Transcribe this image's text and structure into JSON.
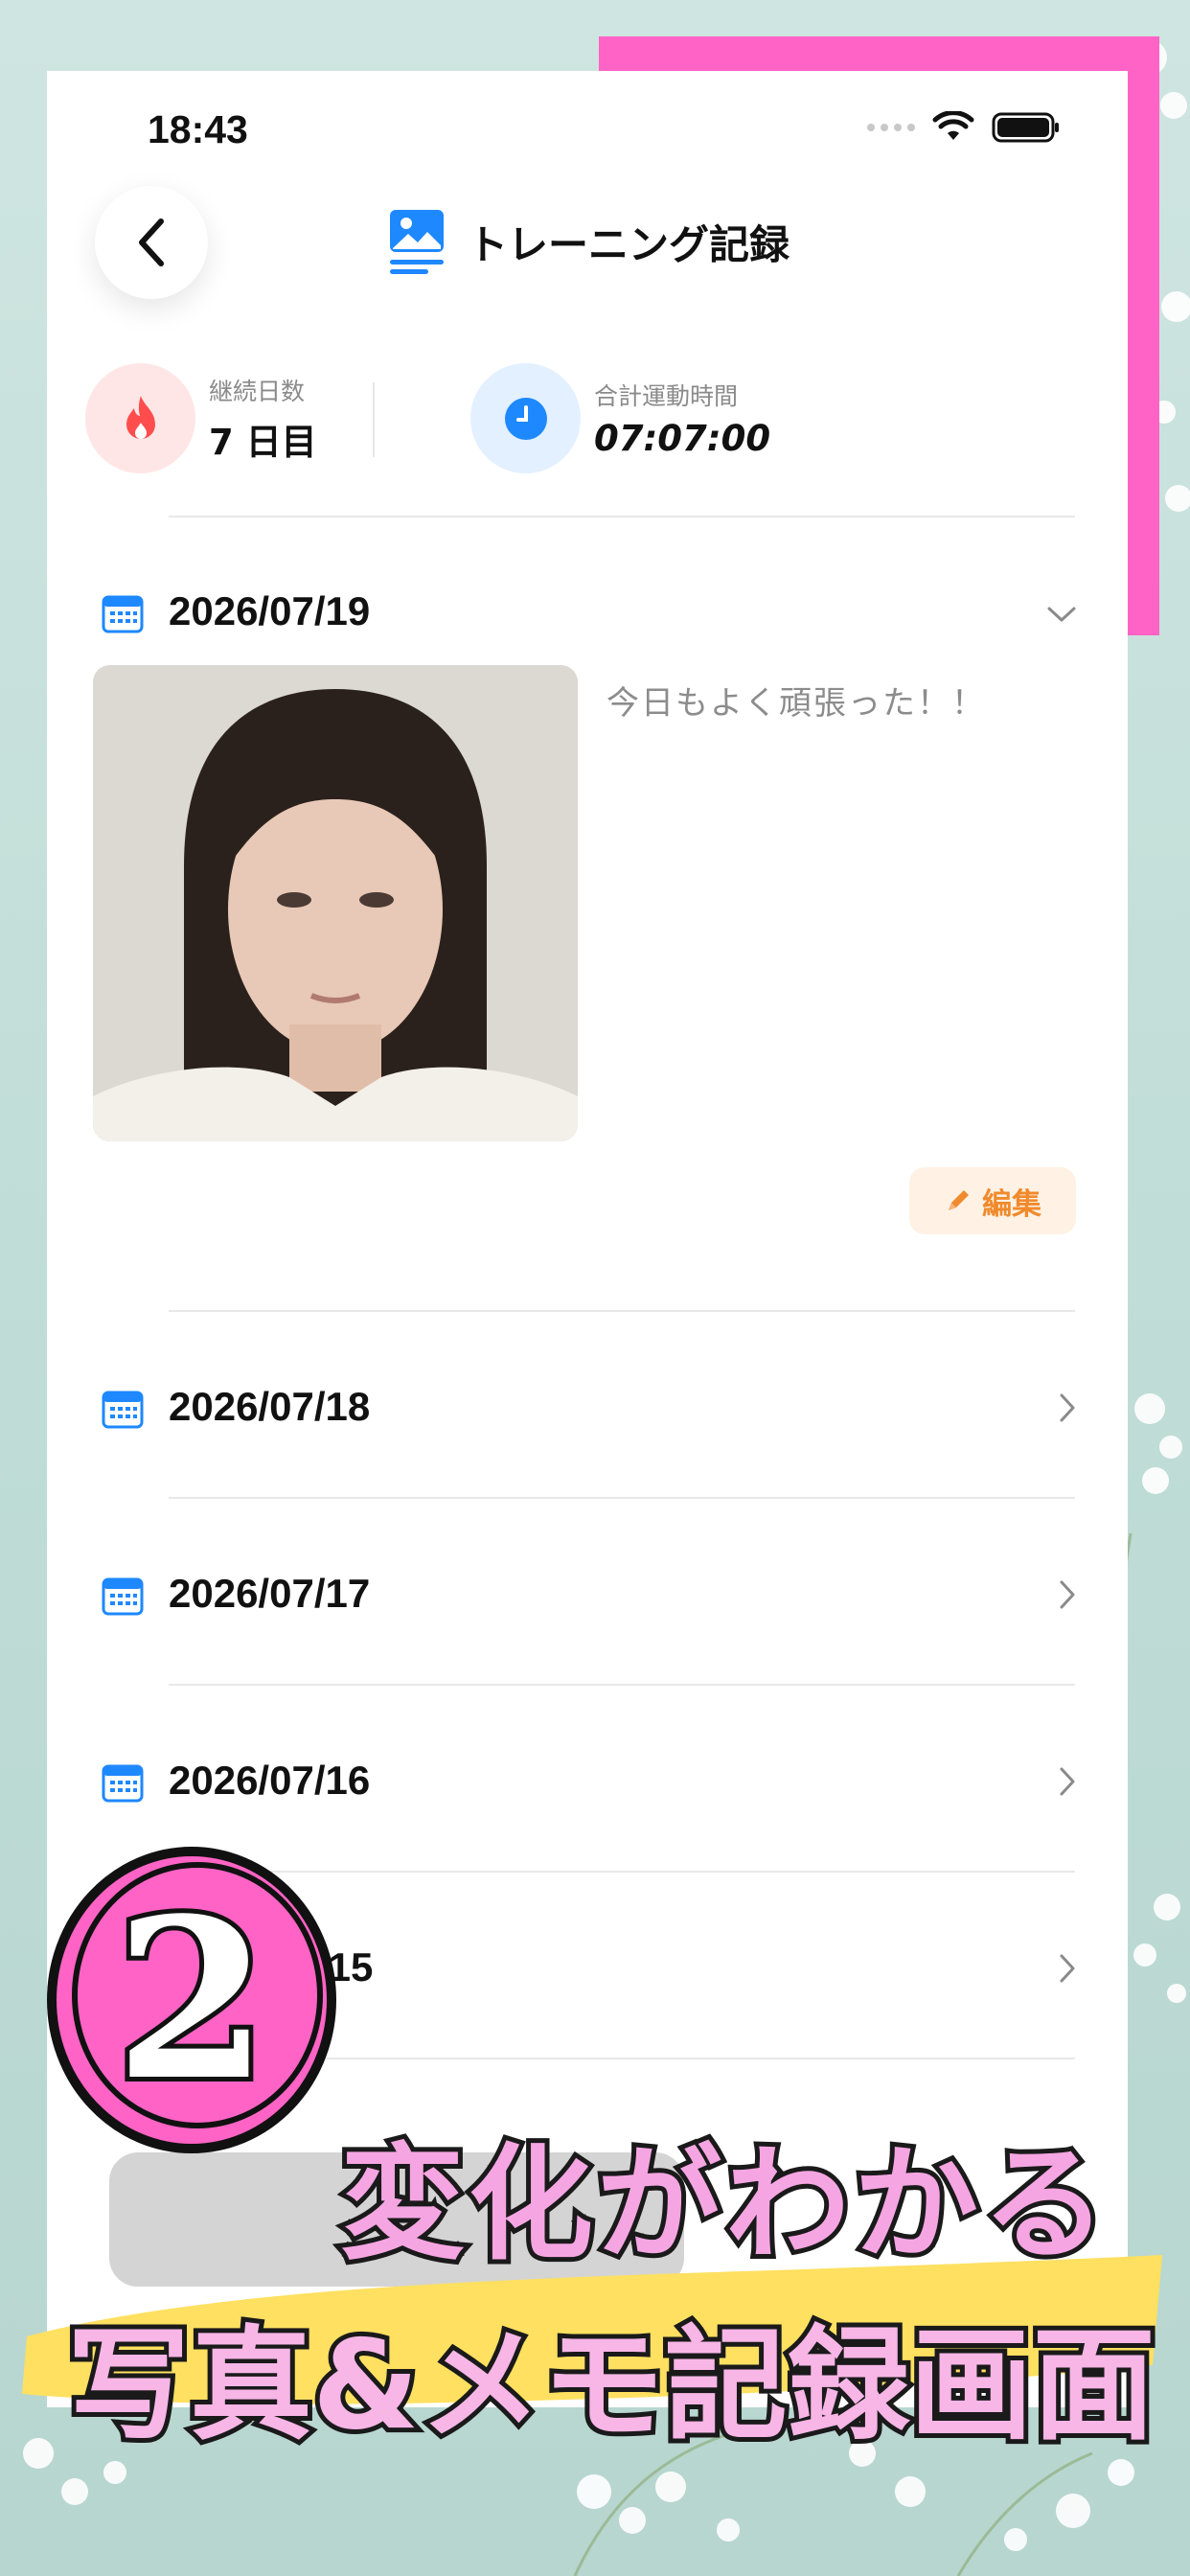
{
  "status": {
    "time": "18:43"
  },
  "header": {
    "title": "トレーニング記録"
  },
  "stats": {
    "streak_label": "継続日数",
    "streak_value": "7 日目",
    "total_label": "合計運動時間",
    "total_value": "07:07:00"
  },
  "entries": [
    {
      "date": "2026/07/19",
      "memo": "今日もよく頑張った！！",
      "edit_label": "編集"
    },
    {
      "date": "2026/07/18"
    },
    {
      "date": "2026/07/17"
    },
    {
      "date": "2026/07/16"
    },
    {
      "date": "/15"
    }
  ],
  "promo": {
    "badge_number": "2",
    "line1": "変化がわかる",
    "line2": "写真&メモ記録画面"
  },
  "colors": {
    "accent_blue": "#1e88ff",
    "fire_red": "#ff4d4d",
    "edit_orange": "#f08a2c",
    "promo_pink": "#ff63c5",
    "promo_yellow": "#ffe060"
  },
  "icons": {
    "back": "chevron-left-icon",
    "header": "image-icon",
    "streak": "fire-icon",
    "total": "clock-icon",
    "calendar": "calendar-icon",
    "expanded": "chevron-down-icon",
    "collapsed": "chevron-right-icon",
    "edit": "pencil-icon"
  }
}
